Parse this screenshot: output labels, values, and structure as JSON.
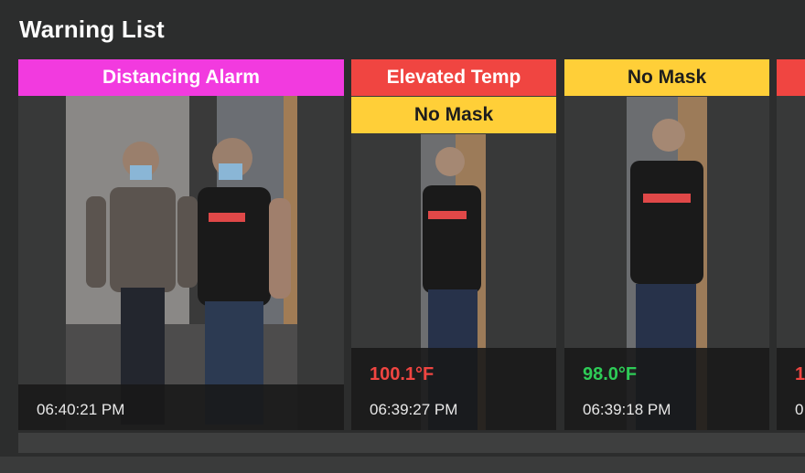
{
  "header": {
    "title": "Warning List"
  },
  "cards": [
    {
      "tags": [
        "Distancing Alarm"
      ],
      "temperature": "",
      "time": "06:40:21 PM"
    },
    {
      "tags": [
        "Elevated Temp",
        "No Mask"
      ],
      "temperature": "100.1°F",
      "time": "06:39:27 PM"
    },
    {
      "tags": [
        "No Mask"
      ],
      "temperature": "98.0°F",
      "time": "06:39:18 PM"
    },
    {
      "tags": [
        ""
      ],
      "temperature": "1",
      "time": "0"
    }
  ],
  "colors": {
    "distancing": "#f23adf",
    "elevated_temp": "#f04541",
    "no_mask": "#ffcf38",
    "temp_high": "#f04541",
    "temp_normal": "#2ecc57",
    "background": "#2c2d2d"
  }
}
